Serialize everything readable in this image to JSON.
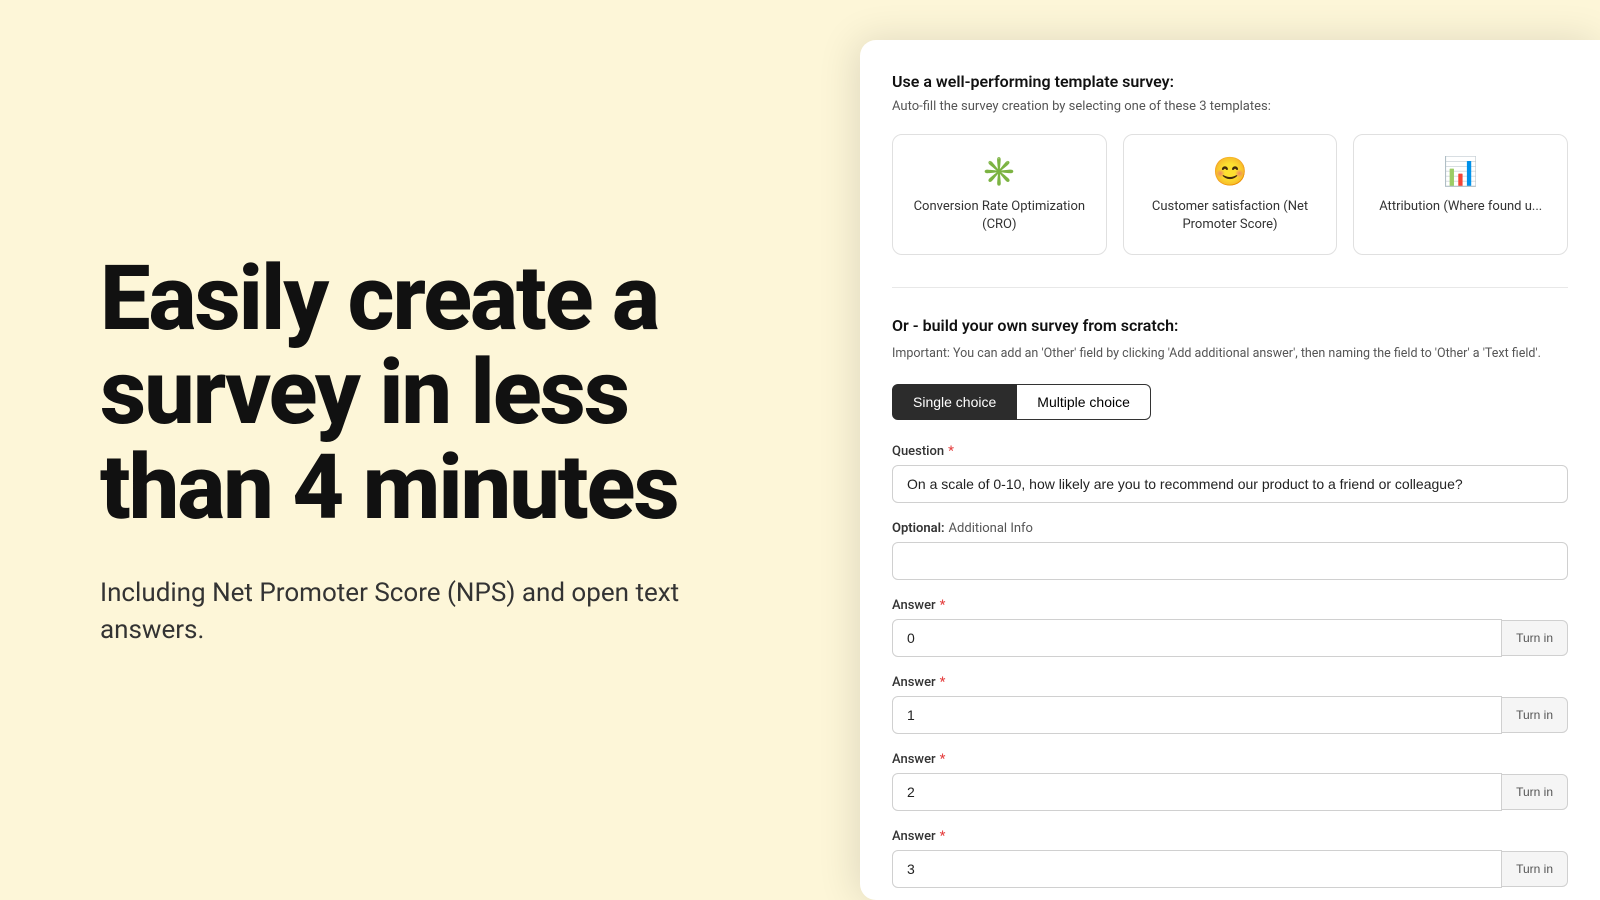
{
  "left": {
    "hero_title": "Easily create a survey in less than 4 minutes",
    "hero_subtitle": "Including Net Promoter Score (NPS) and open text answers."
  },
  "right": {
    "template_section": {
      "title": "Use a well-performing template survey:",
      "subtitle": "Auto-fill the survey creation by selecting one of these 3 templates:",
      "templates": [
        {
          "icon": "✳️",
          "label": "Conversion Rate Optimization (CRO)"
        },
        {
          "icon": "😊",
          "label": "Customer satisfaction (Net Promoter Score)"
        },
        {
          "icon": "📊",
          "label": "Attribution (Where found u..."
        }
      ]
    },
    "scratch_section": {
      "title": "Or - build your own survey from scratch:",
      "note": "Important: You can add an 'Other' field by clicking 'Add additional answer', then naming the field to 'Other' a 'Text field'.",
      "choice_buttons": [
        {
          "label": "Single choice",
          "active": true
        },
        {
          "label": "Multiple choice",
          "active": false
        }
      ],
      "question_label": "Question",
      "question_required": "*",
      "question_value": "On a scale of 0-10, how likely are you to recommend our product to a friend or colleague?",
      "optional_label": "Optional:",
      "optional_sub": "Additional Info",
      "additional_info_value": "",
      "answers": [
        {
          "label": "Answer",
          "required": "*",
          "value": "0",
          "turn_in": "Turn in"
        },
        {
          "label": "Answer",
          "required": "*",
          "value": "1",
          "turn_in": "Turn in"
        },
        {
          "label": "Answer",
          "required": "*",
          "value": "2",
          "turn_in": "Turn in"
        },
        {
          "label": "Answer",
          "required": "*",
          "value": "3",
          "turn_in": "Turn in"
        }
      ]
    }
  }
}
